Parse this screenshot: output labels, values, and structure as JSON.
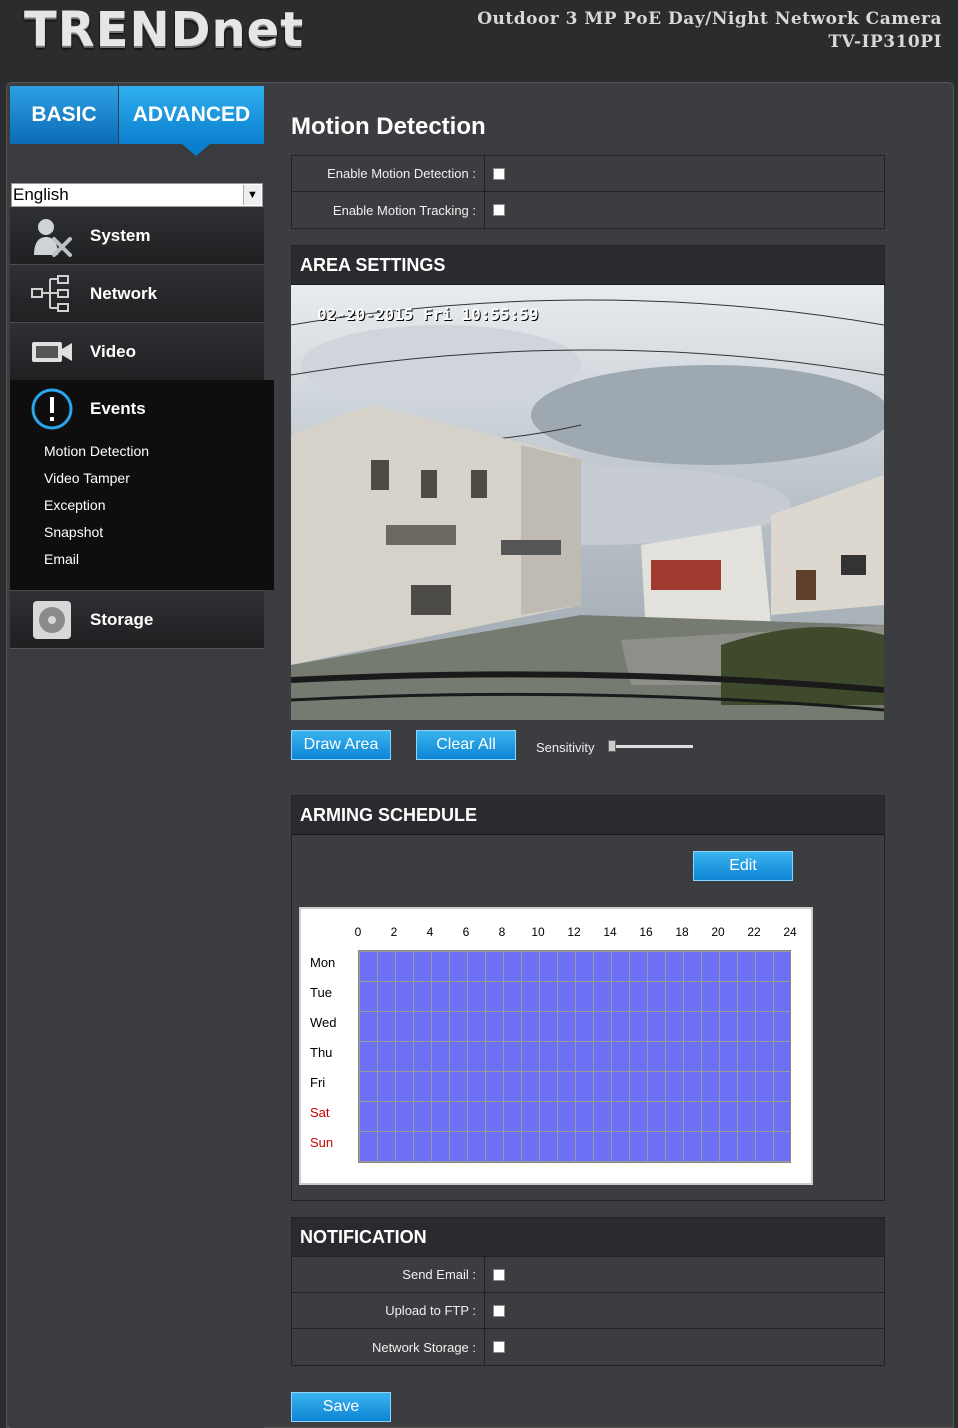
{
  "header": {
    "logo": "TRENDnet",
    "product_line1": "Outdoor 3 MP PoE Day/Night Network Camera",
    "product_line2": "TV-IP310PI"
  },
  "tabs": {
    "basic": "BASIC",
    "advanced": "ADVANCED"
  },
  "language": {
    "selected": "English"
  },
  "nav": {
    "system": "System",
    "network": "Network",
    "video": "Video",
    "events": "Events",
    "events_sub": [
      "Motion Detection",
      "Video Tamper",
      "Exception",
      "Snapshot",
      "Email"
    ],
    "storage": "Storage"
  },
  "page_title": "Motion Detection",
  "motion": {
    "enable_label": "Enable Motion Detection :",
    "tracking_label": "Enable Motion Tracking :"
  },
  "area": {
    "title": "AREA SETTINGS",
    "osd": "02-20-2015 Fri 10:55:59",
    "draw_button": "Draw Area",
    "clear_button": "Clear All",
    "sensitivity_label": "Sensitivity",
    "sensitivity_value": 0
  },
  "schedule": {
    "title": "ARMING SCHEDULE",
    "edit_button": "Edit",
    "hours": [
      "0",
      "2",
      "4",
      "6",
      "8",
      "10",
      "12",
      "14",
      "16",
      "18",
      "20",
      "22",
      "24"
    ],
    "days": [
      "Mon",
      "Tue",
      "Wed",
      "Thu",
      "Fri",
      "Sat",
      "Sun"
    ],
    "weekday_color": "#000000",
    "weekend_color": "#cc0000",
    "fill_color": "#6b70f5"
  },
  "notification": {
    "title": "NOTIFICATION",
    "email_label": "Send Email :",
    "ftp_label": "Upload to FTP :",
    "storage_label": "Network Storage :"
  },
  "save_button": "Save",
  "colors": {
    "accent": "#0d85d4",
    "sidebar_active": "#0e0e0f"
  }
}
